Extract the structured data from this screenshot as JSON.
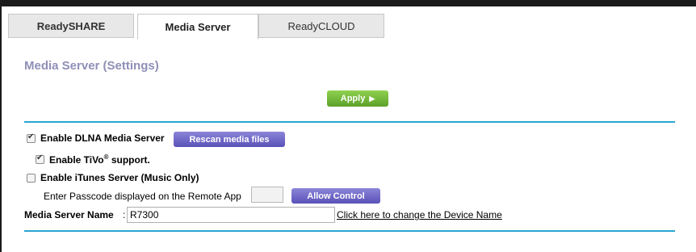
{
  "tabs": [
    {
      "label": "ReadySHARE"
    },
    {
      "label": "Media Server"
    },
    {
      "label": "ReadyCLOUD"
    }
  ],
  "page_title": "Media Server (Settings)",
  "apply_label": "Apply",
  "dlna": {
    "label": "Enable DLNA Media Server",
    "checked": true
  },
  "rescan_label": "Rescan media files",
  "tivo": {
    "label_pre": "Enable TiVo",
    "label_sup": "®",
    "label_post": " support.",
    "checked": true
  },
  "itunes": {
    "label": "Enable iTunes Server (Music Only)",
    "checked": false
  },
  "passcode": {
    "label": "Enter Passcode displayed on the Remote App",
    "value": ""
  },
  "allow_label": "Allow Control",
  "media_server_name": {
    "label": "Media Server Name",
    "colon": ":",
    "value": "R7300"
  },
  "change_link": "Click here to change the Device Name"
}
